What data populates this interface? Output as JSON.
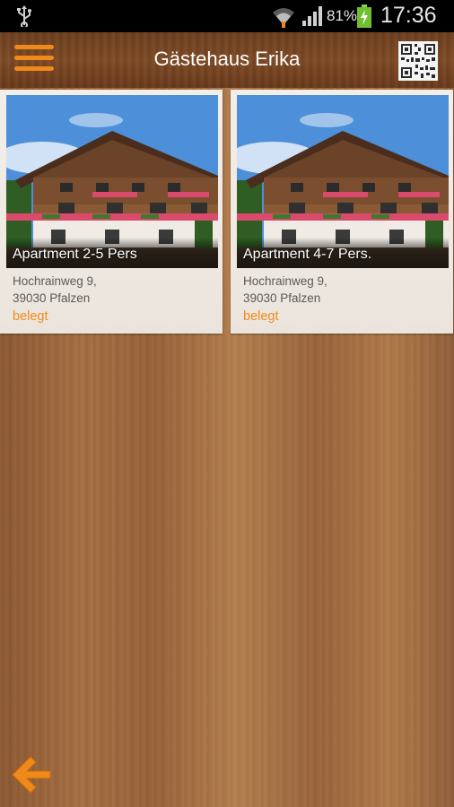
{
  "status_bar": {
    "battery_percent": "81%",
    "time": "17:36",
    "icons": [
      "usb-icon",
      "wifi-icon",
      "signal-icon",
      "battery-charging-icon"
    ]
  },
  "header": {
    "title": "Gästehaus Erika",
    "menu_icon": "hamburger-menu-icon",
    "qr_icon": "qr-code-icon"
  },
  "listings": [
    {
      "title": "Apartment 2-5 Pers",
      "address_line1": "Hochrainweg 9,",
      "address_line2": "39030 Pfalzen",
      "status": "belegt"
    },
    {
      "title": "Apartment 4-7 Pers.",
      "address_line1": "Hochrainweg 9,",
      "address_line2": "39030 Pfalzen",
      "status": "belegt"
    }
  ],
  "footer": {
    "back_icon": "back-arrow-icon"
  },
  "colors": {
    "accent": "#ef8a1a",
    "status_bar_bg": "#000000",
    "app_bar_bg": "#74431f",
    "card_bg": "#f1ece6",
    "address_text": "#5a5a5a"
  }
}
